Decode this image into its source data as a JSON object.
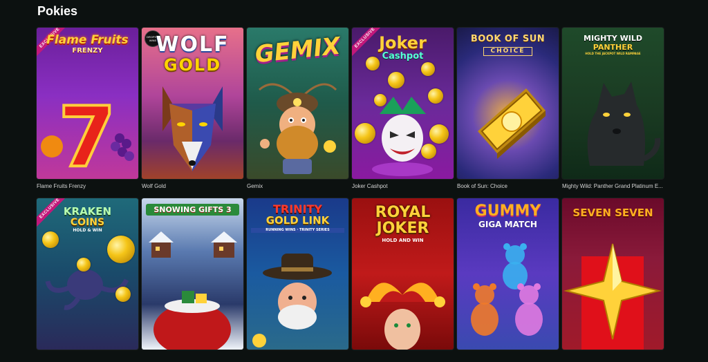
{
  "section": {
    "title": "Pokies"
  },
  "games": [
    {
      "name": "Flame Fruits Frenzy",
      "logo": "Flame Fruits",
      "logo_sub": "FRENZY",
      "ribbon": "EXCLUSIVE",
      "art_icon": "seven-icon"
    },
    {
      "name": "Wolf Gold",
      "logo": "WOLF",
      "logo_sub": "GOLD",
      "badge": "DROPS & WINS",
      "art_icon": "wolf-icon"
    },
    {
      "name": "Gemix",
      "logo": "GEMIX",
      "art_icon": "dwarf-icon"
    },
    {
      "name": "Joker Cashpot",
      "logo": "Joker",
      "logo_sub": "Cashpot",
      "ribbon": "EXCLUSIVE",
      "art_icon": "joker-icon"
    },
    {
      "name": "Book of Sun: Choice",
      "logo": "BOOK OF SUN",
      "logo_sub": "CHOICE",
      "art_icon": "book-icon"
    },
    {
      "name": "Mighty Wild: Panther Grand Platinum E...",
      "logo": "MIGHTY WILD",
      "logo_sub": "PANTHER",
      "logo_note": "HOLD THE JACKPOT WILD RAMPAGE",
      "art_icon": "panther-icon"
    },
    {
      "name": "",
      "logo": "KRAKEN",
      "logo_sub": "COINS",
      "logo_note": "HOLD & WIN",
      "ribbon": "EXCLUSIVE",
      "art_icon": "kraken-icon"
    },
    {
      "name": "",
      "logo": "SNOWING GIFTS 3",
      "art_icon": "gift-sack-icon"
    },
    {
      "name": "",
      "logo": "TRINITY",
      "logo_sub": "GOLD LINK",
      "logo_note": "RUNNING WINS · TRINITY SERIES",
      "art_icon": "cowboy-icon"
    },
    {
      "name": "",
      "logo": "ROYAL",
      "logo_sub": "JOKER",
      "logo_note": "HOLD AND WIN",
      "art_icon": "jester-icon"
    },
    {
      "name": "",
      "logo": "GUMMY",
      "logo_sub": "GIGA MATCH",
      "art_icon": "gummy-bear-icon"
    },
    {
      "name": "",
      "logo": "SEVEN SEVEN",
      "art_icon": "star-icon"
    }
  ],
  "colors": {
    "background": "#0c1110",
    "ribbon": "#c2187a"
  }
}
